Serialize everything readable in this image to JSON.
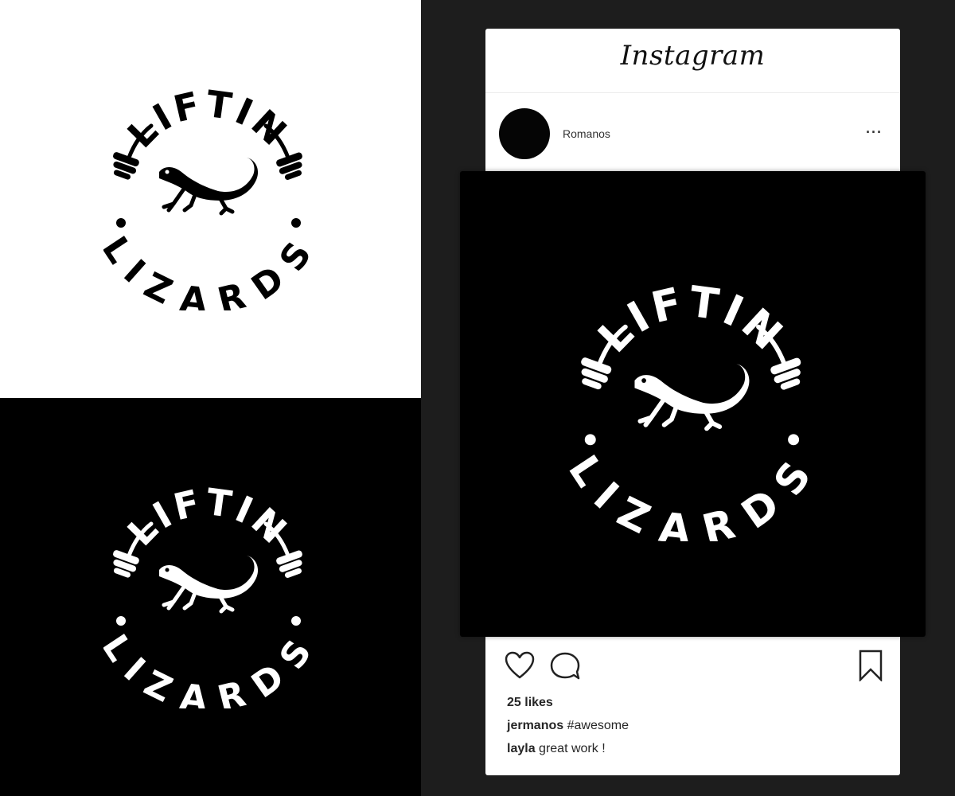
{
  "logo": {
    "top_text": "LIFTIN",
    "bottom_text": "LIZARDS"
  },
  "instagram": {
    "wordmark": "Instagram",
    "username": "Romanos",
    "more": "···",
    "likes": "25 likes",
    "comments": [
      {
        "user": "jermanos",
        "text": "#awesome"
      },
      {
        "user": "layla",
        "text": "great work !"
      }
    ]
  },
  "icons": {
    "like": "heart-icon",
    "comment": "speech-bubble-icon",
    "save": "bookmark-icon",
    "menu": "more-horizontal-icon"
  },
  "colors": {
    "dark": "#000000",
    "light": "#ffffff",
    "background": "#1d1d1d"
  }
}
